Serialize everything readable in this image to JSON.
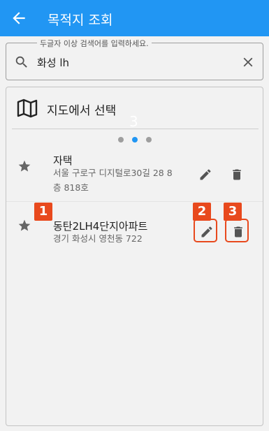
{
  "app_bar": {
    "title": "목적지 조회",
    "back_icon": "arrow-back-icon",
    "color": "#2196f3"
  },
  "search": {
    "legend": "두글자 이상 검색어를 입력하세요.",
    "value": "화성 lh",
    "search_icon": "search-icon",
    "clear_icon": "close-icon"
  },
  "map_select": {
    "icon": "map-icon",
    "label": "지도에서 선택"
  },
  "carousel": {
    "ghost_number": "3",
    "pages": 3,
    "active_page": 2,
    "active_color": "#2196f3",
    "inactive_color": "#9e9e9e"
  },
  "places": [
    {
      "name": "자택",
      "address": "서울 구로구 디지털로30길 28 8층 818호",
      "star_icon": "star-icon",
      "edit_icon": "pencil-icon",
      "delete_icon": "trash-icon"
    },
    {
      "name": "동탄2LH4단지아파트",
      "address": "경기 화성시 영천동 722",
      "star_icon": "star-icon",
      "edit_icon": "pencil-icon",
      "delete_icon": "trash-icon"
    }
  ],
  "annotations": {
    "badge_1": "1",
    "badge_2": "2",
    "badge_3": "3",
    "color": "#e8491d"
  }
}
